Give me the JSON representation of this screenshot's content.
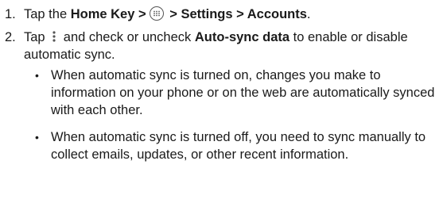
{
  "step1": {
    "number": "1.",
    "prefix": "Tap the ",
    "home_key": "Home Key >",
    "suffix": " > Settings > Accounts",
    "period": ".",
    "apps_icon": "apps-grid-icon"
  },
  "step2": {
    "number": "2.",
    "prefix": "Tap ",
    "menu_icon": "overflow-menu-icon",
    "middle": " and check or uncheck ",
    "auto_sync": "Auto-sync data",
    "suffix": " to enable or disable automatic sync."
  },
  "bullets": [
    {
      "dot": "•",
      "text": "When automatic sync is turned on, changes you make to information on your phone or on the web are automatically synced with each other."
    },
    {
      "dot": "•",
      "text": "When automatic sync is turned off, you need to sync manually to collect emails, updates, or other recent information."
    }
  ]
}
